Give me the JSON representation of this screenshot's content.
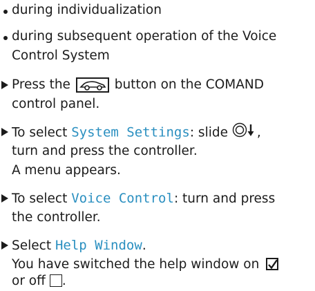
{
  "bullets": [
    {
      "lines": [
        "during individualization"
      ]
    },
    {
      "lines": [
        "during subsequent operation of the Voice",
        "Control System"
      ]
    }
  ],
  "steps": [
    {
      "line1_before": "Press the",
      "button_icon": "car-icon",
      "line1_after": "button on the COMAND",
      "line2": "control panel."
    },
    {
      "line1_before": "To select",
      "menu_item": "System Settings",
      "line1_after": ": slide",
      "controller_icon": "controller-slide-down-icon",
      "line2": "turn and press the controller.",
      "line3": "A menu appears."
    },
    {
      "line1_before": "To select",
      "menu_item": "Voice Control",
      "line1_after": ": turn and press",
      "line2": "the controller."
    },
    {
      "line1_before": "Select",
      "menu_item": "Help Window",
      "line1_after": ".",
      "line2": "You have switched the help window on",
      "checked_icon": "checked-box-icon",
      "line3": "or off",
      "unchecked_icon": "empty-box-icon",
      "line3_end": "."
    }
  ]
}
